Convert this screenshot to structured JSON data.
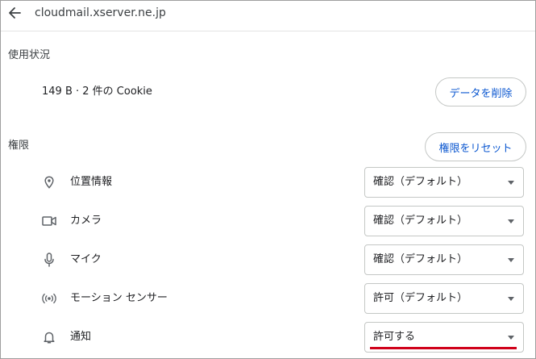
{
  "header": {
    "site": "cloudmail.xserver.ne.jp",
    "back_icon": "arrow-left-icon"
  },
  "usage": {
    "heading": "使用状況",
    "summary": "149 B · 2 件の Cookie",
    "delete_button": "データを削除"
  },
  "permissions": {
    "heading": "権限",
    "reset_button": "権限をリセット",
    "items": [
      {
        "icon": "location-pin-icon",
        "label": "位置情報",
        "value": "確認（デフォルト）"
      },
      {
        "icon": "camera-icon",
        "label": "カメラ",
        "value": "確認（デフォルト）"
      },
      {
        "icon": "microphone-icon",
        "label": "マイク",
        "value": "確認（デフォルト）"
      },
      {
        "icon": "motion-sensor-icon",
        "label": "モーション センサー",
        "value": "許可（デフォルト）"
      },
      {
        "icon": "bell-icon",
        "label": "通知",
        "value": "許可する"
      }
    ]
  },
  "annotation": {
    "underline_color": "#d0021b"
  }
}
